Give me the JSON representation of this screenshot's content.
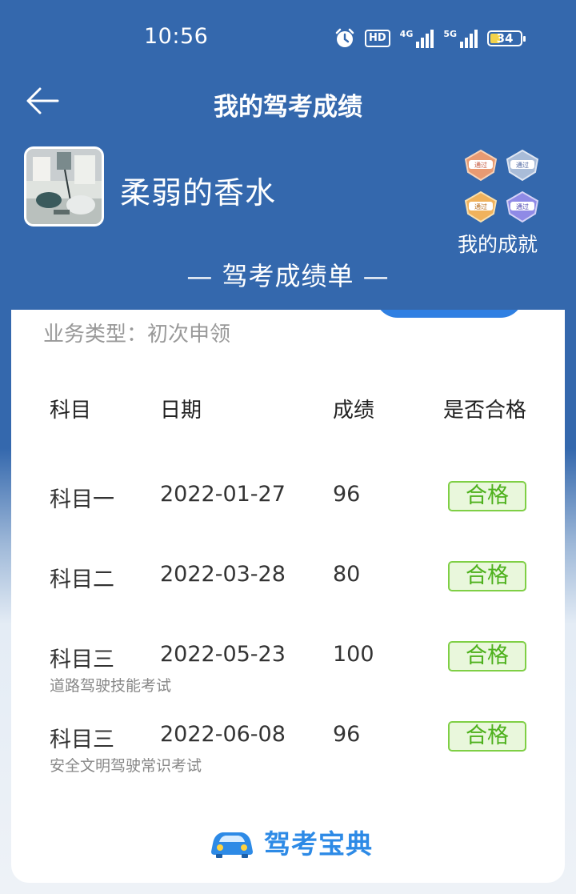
{
  "status_bar": {
    "time": "10:56",
    "battery": "34",
    "net1": "4G",
    "net2": "5G",
    "hd": "HD"
  },
  "nav": {
    "title": "我的驾考成绩"
  },
  "profile": {
    "name": "柔弱的香水",
    "achievements_label": "我的成就",
    "badge_text": "通过"
  },
  "section_title": "— 驾考成绩单 —",
  "card": {
    "business": "业务类型：初次申领",
    "headers": [
      "科目",
      "日期",
      "成绩",
      "是否合格"
    ],
    "rows": [
      {
        "subject": "科目一",
        "date": "2022-01-27",
        "score": "96",
        "result": "合格",
        "note": ""
      },
      {
        "subject": "科目二",
        "date": "2022-03-28",
        "score": "80",
        "result": "合格",
        "note": ""
      },
      {
        "subject": "科目三",
        "date": "2022-05-23",
        "score": "100",
        "result": "合格",
        "note": "道路驾驶技能考试"
      },
      {
        "subject": "科目三",
        "date": "2022-06-08",
        "score": "96",
        "result": "合格",
        "note": "安全文明驾驶常识考试"
      }
    ],
    "brand": "驾考宝典"
  },
  "colors": {
    "primary": "#3468ad",
    "pass_green": "#4eb11d",
    "brand_blue": "#2d8ae6"
  },
  "icons": [
    "back-arrow-icon",
    "alarm-icon",
    "signal-icon",
    "battery-icon",
    "badge-icon",
    "car-icon"
  ]
}
